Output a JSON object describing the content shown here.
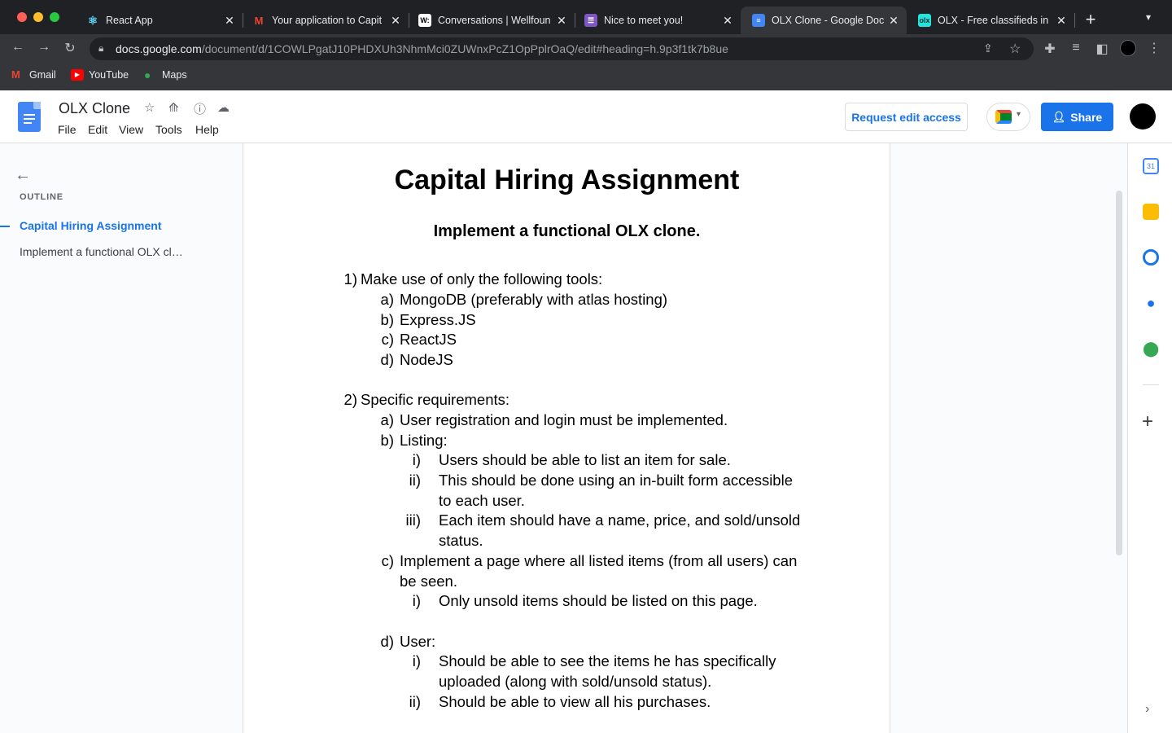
{
  "browser": {
    "tabs": [
      {
        "title": "React App",
        "icon": "react-icon",
        "color": "#61dafb"
      },
      {
        "title": "Your application to Capit",
        "icon": "gmail-icon",
        "color": "#ea4335"
      },
      {
        "title": "Conversations | Wellfoun",
        "icon": "wellfound-icon",
        "color": "#ffffff"
      },
      {
        "title": "Nice to meet you!",
        "icon": "form-icon",
        "color": "#7e57c2"
      },
      {
        "title": "OLX Clone - Google Doc",
        "icon": "docs-icon",
        "color": "#4285f4",
        "active": true
      },
      {
        "title": "OLX - Free classifieds in",
        "icon": "olx-icon",
        "color": "#23e5db"
      }
    ],
    "new_tab": "+",
    "url_host": "docs.google.com",
    "url_path": "/document/d/1COWLPgatJ10PHDXUh3NhmMci0ZUWnxPcZ1OpPplrOaQ/edit#heading=h.9p3f1tk7b8ue",
    "bookmarks": [
      "Gmail",
      "YouTube",
      "Maps"
    ]
  },
  "docs": {
    "title": "OLX Clone",
    "menu": [
      "File",
      "Edit",
      "View",
      "Tools",
      "Help"
    ],
    "request_edit": "Request edit access",
    "share": "Share"
  },
  "outline": {
    "label": "OUTLINE",
    "items": [
      "Capital Hiring Assignment",
      "Implement a functional OLX cl…"
    ]
  },
  "document": {
    "h1": "Capital Hiring Assignment",
    "h2": "Implement a functional OLX clone.",
    "lines": [
      {
        "m": "1)",
        "t": "Make use of only the following tools:"
      },
      {
        "m": "a)",
        "t": "MongoDB (preferably with atlas hosting)"
      },
      {
        "m": "b)",
        "t": "Express.JS"
      },
      {
        "m": "c)",
        "t": "ReactJS"
      },
      {
        "m": "d)",
        "t": "NodeJS"
      },
      {
        "m": "2)",
        "t": "Specific requirements:"
      },
      {
        "m": "a)",
        "t": "User registration and login must be implemented."
      },
      {
        "m": "b)",
        "t": "Listing:"
      },
      {
        "m": "i)",
        "t": "Users should be able to list an item for sale."
      },
      {
        "m": "ii)",
        "t": "This should be done using an in-built form accessible"
      },
      {
        "m": "",
        "t": "to each user."
      },
      {
        "m": "iii)",
        "t": "Each item should have a name, price, and sold/unsold"
      },
      {
        "m": "",
        "t": "status."
      },
      {
        "m": "c)",
        "t": "Implement a page where all listed items (from all users) can"
      },
      {
        "m": "",
        "t": "be seen."
      },
      {
        "m": "i)",
        "t": " Only unsold items should be listed on this page."
      },
      {
        "m": "d)",
        "t": "User:"
      },
      {
        "m": "i)",
        "t": "Should be able to see the items he has specifically"
      },
      {
        "m": "",
        "t": "uploaded (along with sold/unsold status)."
      },
      {
        "m": "ii)",
        "t": "Should be able to view all his purchases."
      }
    ]
  },
  "colors": {
    "accent": "#1a73e8",
    "chrome": "#202124",
    "toolbar": "#35363a"
  }
}
